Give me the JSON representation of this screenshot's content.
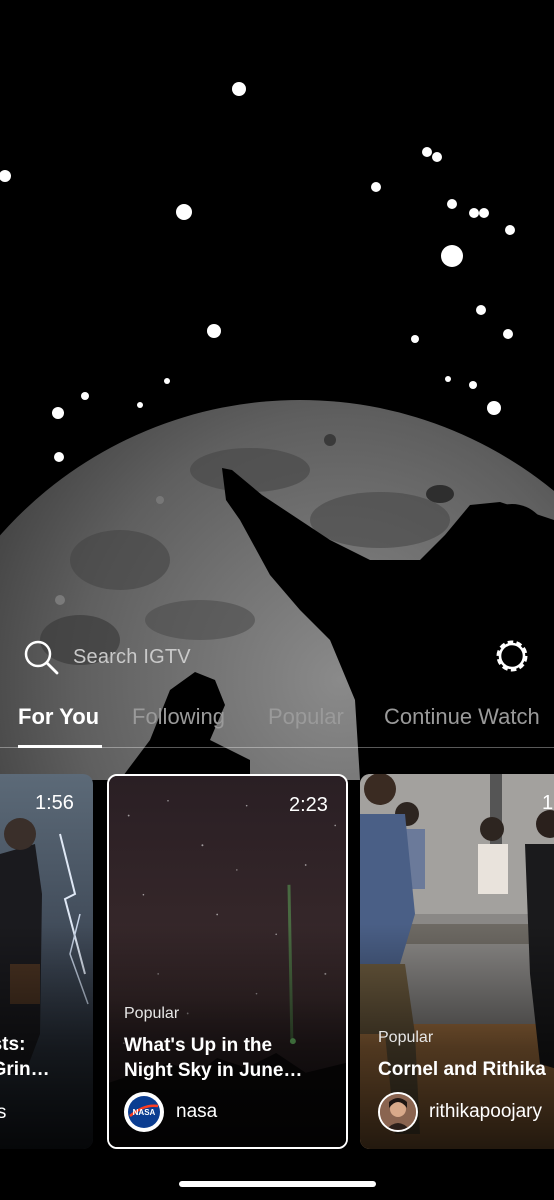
{
  "search": {
    "placeholder": "Search IGTV",
    "icon": "search-icon",
    "settings_icon": "gear-icon"
  },
  "tabs": [
    {
      "label": "For You",
      "active": true
    },
    {
      "label": "Following",
      "active": false
    },
    {
      "label": "Popular",
      "active": false
    },
    {
      "label": "Continue Watch",
      "active": false
    }
  ],
  "cards": [
    {
      "duration": "1:56",
      "title_line1": "nsts:",
      "title_line2": "f Grin…",
      "channel": "res"
    },
    {
      "duration": "2:23",
      "category": "Popular",
      "title_line1": "What's Up in the",
      "title_line2": "Night Sky in June…",
      "channel": "nasa",
      "avatar_text": "NASA",
      "selected": true
    },
    {
      "duration": "1",
      "category": "Popular",
      "title_line1": "Cornel and Rithika",
      "channel": "rithikapoojary"
    }
  ],
  "colors": {
    "background": "#000000",
    "active_tab": "#ffffff",
    "inactive_tab": "#9a9a9a",
    "nasa_blue": "#0b3d91",
    "nasa_red": "#fc3d21"
  }
}
